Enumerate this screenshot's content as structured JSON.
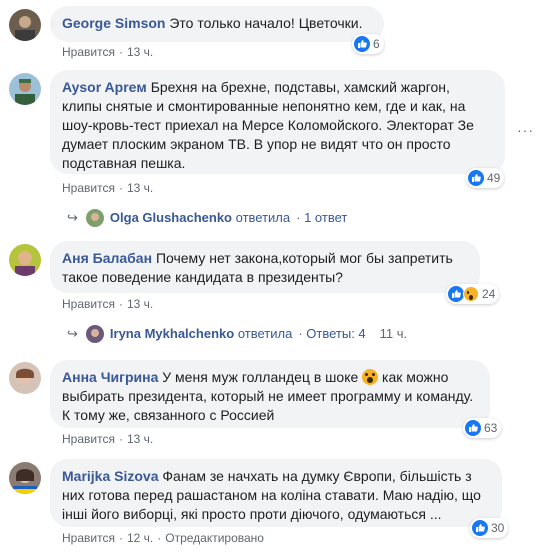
{
  "comments": [
    {
      "author": "George Simson",
      "text": "Это только начало! Цветочки.",
      "like_label": "Нравится",
      "time": "13 ч.",
      "reactions": "6"
    },
    {
      "author": "Aysor Apreм",
      "text": "Брехня на брехне, подставы, хамский жаргон, клипы снятые и смонтированные непонятно кем, где и как, на шоу-кровь-тест приехал на Мерсе Коломойского. Электорат Зе думает плоским экраном ТВ. В упор не видят что он просто подставная пешка.",
      "like_label": "Нравится",
      "time": "13 ч.",
      "reactions": "49",
      "reply": {
        "author": "Olga Glushachenko",
        "action": "ответила",
        "count": "1 ответ"
      }
    },
    {
      "author": "Аня Балабан",
      "text": "Почему нет закона,который мог бы запретить такое поведение кандидата в президенты?",
      "like_label": "Нравится",
      "time": "13 ч.",
      "reactions": "24",
      "reply": {
        "author": "Iryna Mykhalchenko",
        "action": "ответила",
        "count": "Ответы: 4",
        "time": "11 ч."
      }
    },
    {
      "author": "Анна Чигрина",
      "text_before": "У меня муж голландец в шоке",
      "text_after": "как можно выбирать президента, который не имеет программу и команду. К тому же, связанного с Россией",
      "like_label": "Нравится",
      "time": "13 ч.",
      "reactions": "63"
    },
    {
      "author": "Marijka Sizova",
      "text": "Фанам зе начхать на думку Європи, більшість з них готова перед рашастаном на коліна ставати. Маю надію, що інші його виборці, які просто проти діючого, одумаються ...",
      "like_label": "Нравится",
      "time": "12 ч.",
      "edited": "Отредактировано",
      "reactions": "30"
    }
  ],
  "more_options": "···",
  "icons": [
    "like-icon",
    "wow-icon",
    "reply-arrow-icon",
    "astonished-emoji-icon"
  ],
  "colors": {
    "author": "#385898",
    "bubble": "#f2f3f5",
    "like": "#1877f2",
    "meta": "#606770"
  }
}
